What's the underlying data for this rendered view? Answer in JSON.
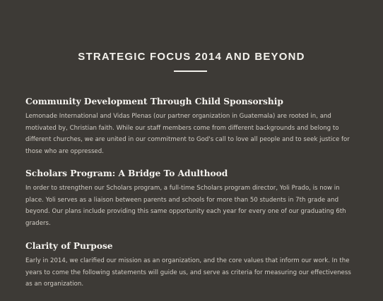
{
  "page": {
    "title": "STRATEGIC FOCUS 2014 AND BEYOND"
  },
  "sections": [
    {
      "heading": "Community Development Through Child Sponsorship",
      "body": "Lemonade International and Vidas Plenas (our partner organization in Guatemala) are rooted in, and motivated by, Christian faith. While our staff members come from different backgrounds and belong to different churches, we are united in our commitment to God's call to love all people and to seek justice for those who are oppressed."
    },
    {
      "heading": "Scholars Program: A Bridge To Adulthood",
      "body": "In order to strengthen our Scholars program, a full-time Scholars program director, Yoli Prado, is now in place. Yoli serves as a liaison between parents and schools for more than 50 students in 7th grade and beyond. Our plans include providing this same opportunity each year for every one of our graduating 6th graders."
    },
    {
      "heading": "Clarity of Purpose",
      "body": "Early in 2014, we clarified our mission as an organization, and the core values that inform our work. In the years to come the following statements will guide us, and serve as criteria for measuring our effectiveness as an organization."
    }
  ]
}
